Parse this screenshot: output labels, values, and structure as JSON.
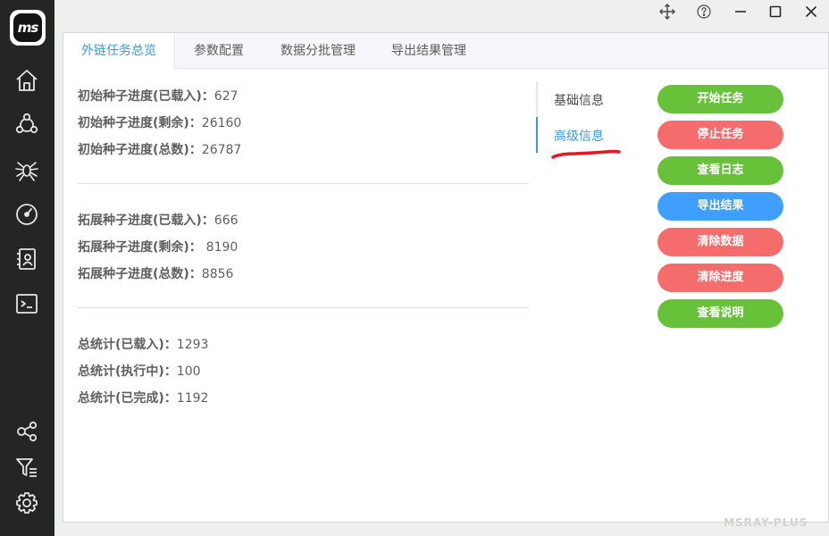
{
  "app": {
    "logo_text": "ms",
    "watermark": "MSRAY-PLUS"
  },
  "sidebar": {
    "top_icons": [
      "home-icon",
      "network-share-icon",
      "spider-icon",
      "dashboard-gauge-icon",
      "contacts-icon",
      "terminal-icon"
    ],
    "bottom_icons": [
      "nodes-icon",
      "filter-list-icon",
      "settings-gear-icon"
    ]
  },
  "window_controls": [
    "move-icon",
    "help-icon",
    "minimize-icon",
    "maximize-icon",
    "close-icon"
  ],
  "tabs": [
    {
      "label": "外链任务总览",
      "active": true
    },
    {
      "label": "参数配置",
      "active": false
    },
    {
      "label": "数据分批管理",
      "active": false
    },
    {
      "label": "导出结果管理",
      "active": false
    }
  ],
  "stats": {
    "initial_seed": [
      {
        "label": "初始种子进度(已载入)：",
        "value": "627"
      },
      {
        "label": "初始种子进度(剩余)：",
        "value": "26160"
      },
      {
        "label": "初始种子进度(总数)：",
        "value": "26787"
      }
    ],
    "expand_seed": [
      {
        "label": "拓展种子进度(已载入)：",
        "value": "666"
      },
      {
        "label": "拓展种子进度(剩余)： ",
        "value": "8190"
      },
      {
        "label": "拓展种子进度(总数)：",
        "value": "8856"
      }
    ],
    "total": [
      {
        "label": "总统计(已载入)：",
        "value": "1293"
      },
      {
        "label": "总统计(执行中)：",
        "value": "100"
      },
      {
        "label": "总统计(已完成)：",
        "value": "1192"
      }
    ]
  },
  "info_tabs": [
    {
      "label": "基础信息",
      "active": false
    },
    {
      "label": "高级信息",
      "active": true
    }
  ],
  "actions": [
    {
      "label": "开始任务",
      "color": "#67c23a"
    },
    {
      "label": "停止任务",
      "color": "#f56c6c"
    },
    {
      "label": "查看日志",
      "color": "#67c23a"
    },
    {
      "label": "导出结果",
      "color": "#409eff"
    },
    {
      "label": "清除数据",
      "color": "#f56c6c"
    },
    {
      "label": "清除进度",
      "color": "#f56c6c"
    },
    {
      "label": "查看说明",
      "color": "#67c23a"
    }
  ],
  "colors": {
    "sidebar_bg": "#252525",
    "accent": "#3a98db",
    "annotation_red": "#e8141e"
  }
}
